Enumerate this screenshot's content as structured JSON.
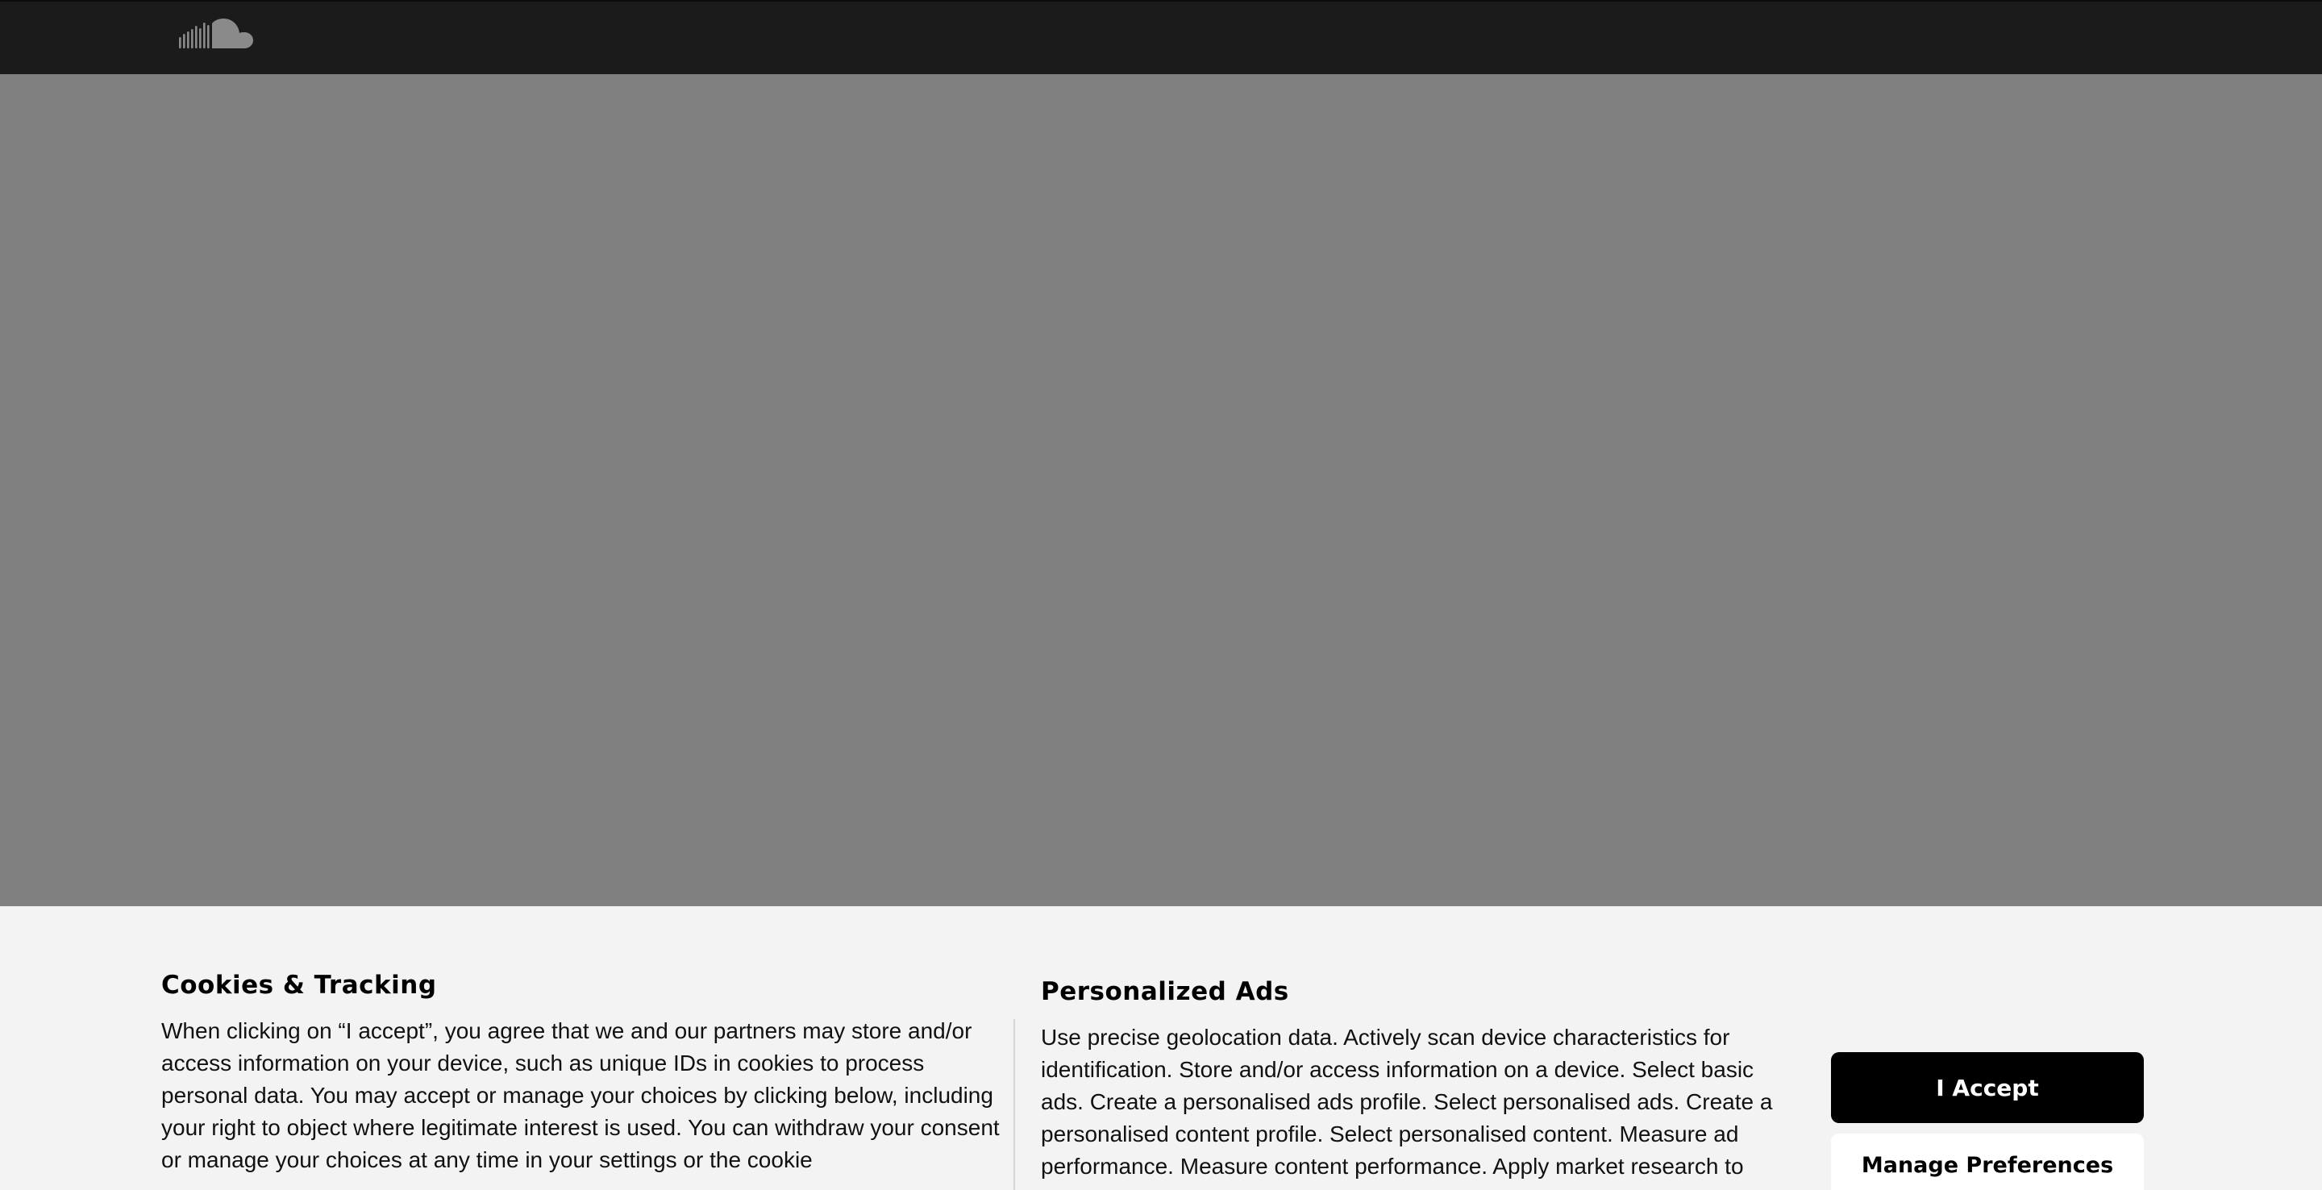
{
  "header": {
    "logo_icon": "soundcloud-logo-icon",
    "logo_color": "#8a8a8a",
    "background": "#1b1b1b"
  },
  "overlay": {
    "color": "#808080"
  },
  "cookie_banner": {
    "title": "Cookies & Tracking",
    "description": "When clicking on “I accept”, you agree that we and our partners may store and/or access information on your device, such as unique IDs in cookies to process personal data. You may accept or manage your choices by clicking below, including your right to object where legitimate interest is used. You can withdraw your consent or manage your choices at any time in your settings or the cookie",
    "ads_title": "Personalized Ads",
    "ads_description": "Use precise geolocation data. Actively scan device characteristics for identification. Store and/or access information on a device. Select basic ads. Create a personalised ads profile. Select personalised ads. Create a personalised content profile. Select personalised content. Measure ad performance. Measure content performance. Apply market research to",
    "accept_label": "I Accept",
    "manage_label": "Manage Preferences"
  }
}
